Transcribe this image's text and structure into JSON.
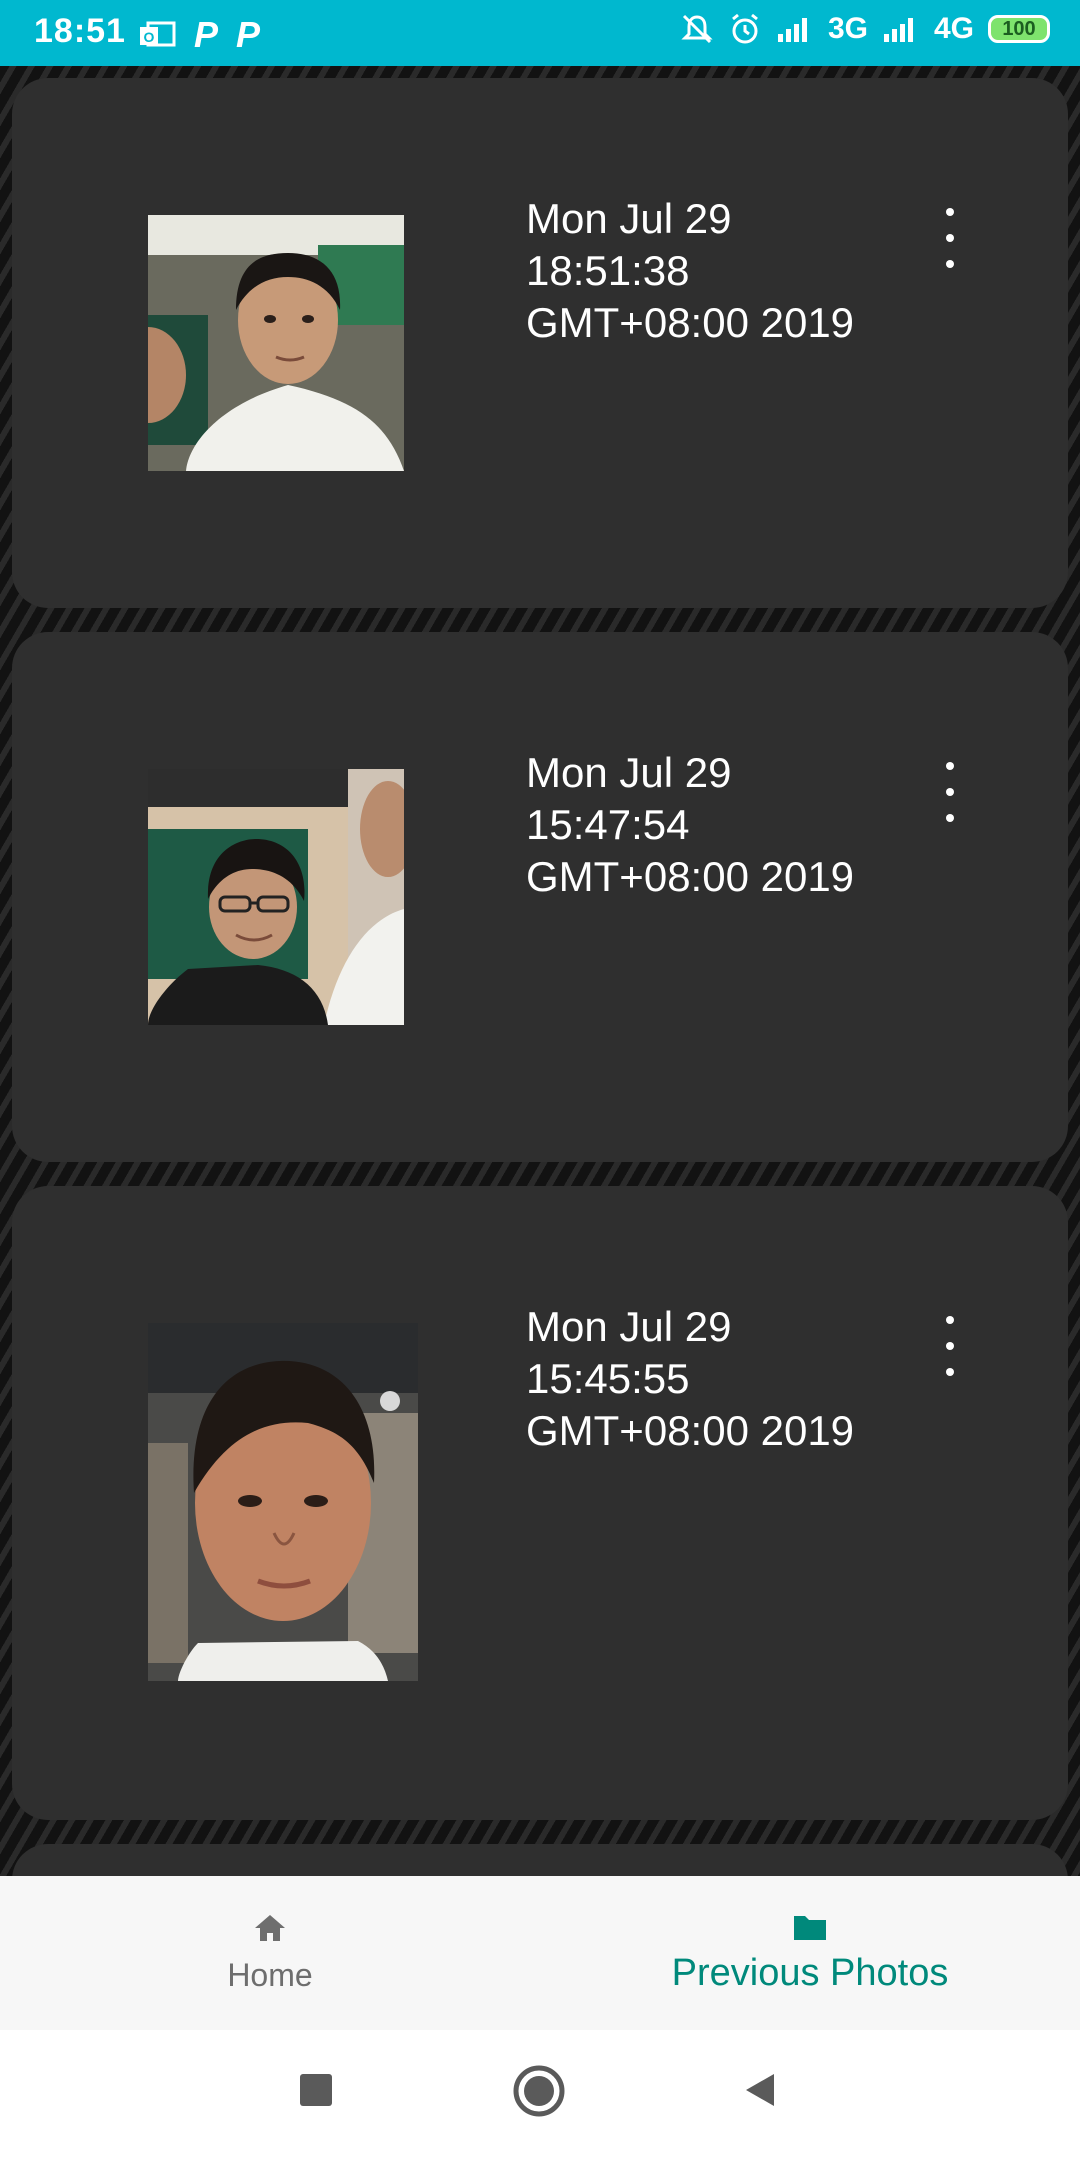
{
  "status_bar": {
    "time": "18:51",
    "net1": "3G",
    "net2": "4G",
    "battery": "100",
    "accent_color": "#00b8cf"
  },
  "photos": [
    {
      "line1": "Mon Jul 29",
      "line2": "18:51:38",
      "line3": "GMT+08:00 2019",
      "menu_icon": "more-vertical-icon"
    },
    {
      "line1": "Mon Jul 29",
      "line2": "15:47:54",
      "line3": "GMT+08:00 2019",
      "menu_icon": "more-vertical-icon"
    },
    {
      "line1": "Mon Jul 29",
      "line2": "15:45:55",
      "line3": "GMT+08:00 2019",
      "menu_icon": "more-vertical-icon"
    }
  ],
  "bottom_nav": {
    "home_label": "Home",
    "photos_label": "Previous Photos",
    "active_color": "#00897b",
    "inactive_color": "#6e6e6e"
  }
}
